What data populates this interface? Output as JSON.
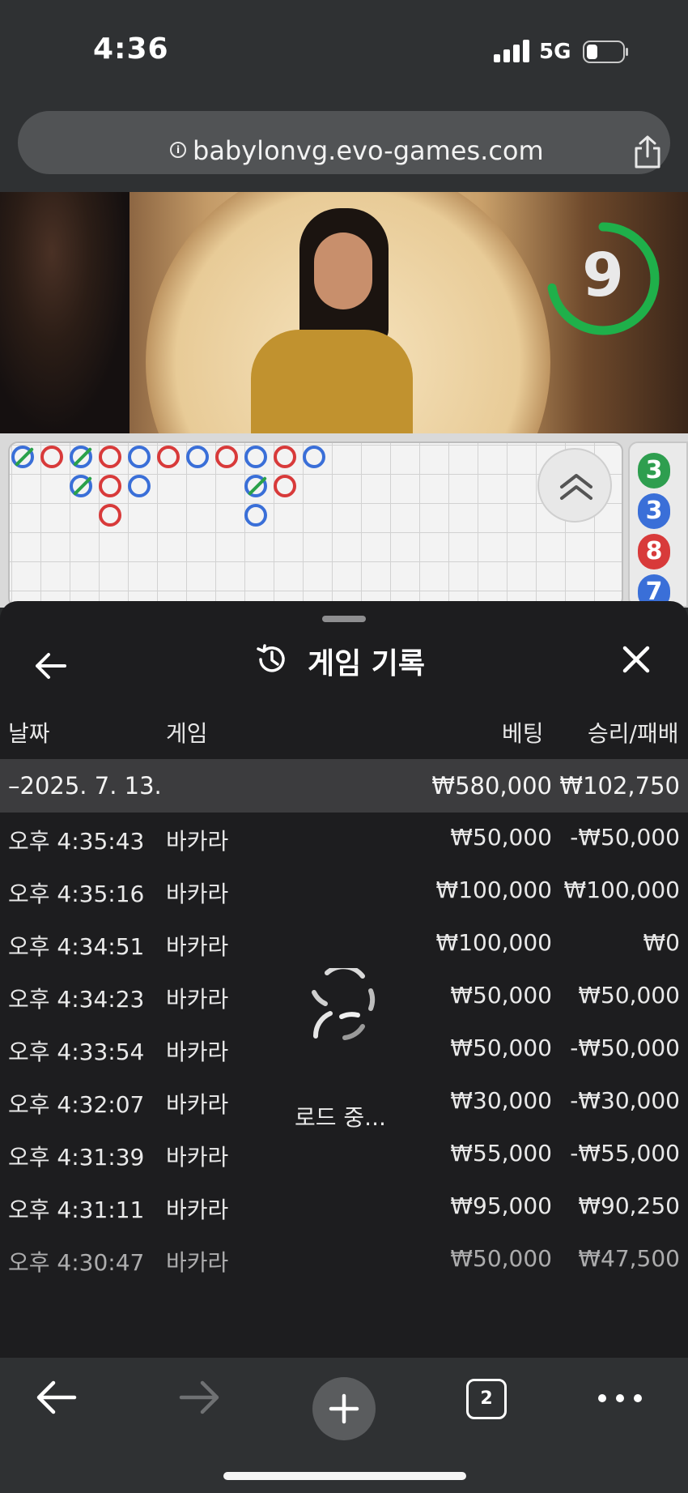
{
  "status_bar": {
    "time": "4:36",
    "network": "5G"
  },
  "browser": {
    "url": "babylonvg.evo-games.com",
    "tab_count": "2"
  },
  "video": {
    "countdown": "9",
    "ticker": ""
  },
  "side_chips": [
    "3",
    "3",
    "8",
    "7"
  ],
  "sheet": {
    "title": "게임 기록",
    "columns": {
      "date": "날짜",
      "game": "게임",
      "bet": "베팅",
      "winloss": "승리/패배"
    },
    "day_summary": {
      "date": "–2025. 7. 13.",
      "bet": "₩580,000",
      "winloss": "₩102,750"
    },
    "rows": [
      {
        "time": "오후 4:35:43",
        "game": "바카라",
        "bet": "₩50,000",
        "winloss": "-₩50,000"
      },
      {
        "time": "오후 4:35:16",
        "game": "바카라",
        "bet": "₩100,000",
        "winloss": "₩100,000"
      },
      {
        "time": "오후 4:34:51",
        "game": "바카라",
        "bet": "₩100,000",
        "winloss": "₩0"
      },
      {
        "time": "오후 4:34:23",
        "game": "바카라",
        "bet": "₩50,000",
        "winloss": "₩50,000"
      },
      {
        "time": "오후 4:33:54",
        "game": "바카라",
        "bet": "₩50,000",
        "winloss": "-₩50,000"
      },
      {
        "time": "오후 4:32:07",
        "game": "바카라",
        "bet": "₩30,000",
        "winloss": "-₩30,000"
      },
      {
        "time": "오후 4:31:39",
        "game": "바카라",
        "bet": "₩55,000",
        "winloss": "-₩55,000"
      },
      {
        "time": "오후 4:31:11",
        "game": "바카라",
        "bet": "₩95,000",
        "winloss": "₩90,250"
      },
      {
        "time": "오후 4:30:47",
        "game": "바카라",
        "bet": "₩50,000",
        "winloss": "₩47,500"
      }
    ],
    "loading_text": "로드 중..."
  },
  "colors": {
    "player": "#3a6fd8",
    "banker": "#d83a3a",
    "tie": "#2aa14a",
    "timer": "#1fb04a"
  }
}
